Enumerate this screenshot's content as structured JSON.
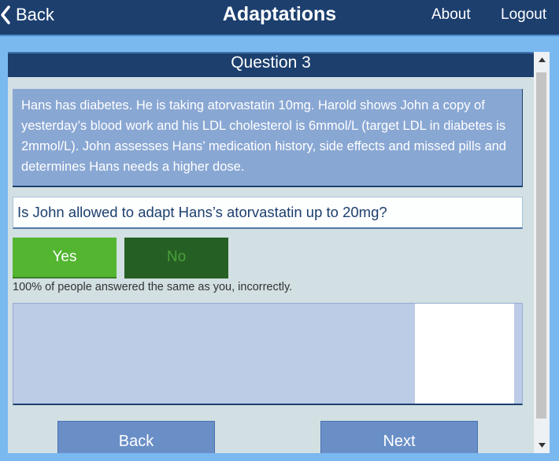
{
  "header": {
    "back_label": "Back",
    "title": "Adaptations",
    "about_label": "About",
    "logout_label": "Logout"
  },
  "question": {
    "heading": "Question 3",
    "scenario": "Hans has diabetes. He is taking atorvastatin 10mg. Harold shows John a copy of yesterday’s blood work and his LDL cholesterol is 6mmol/L (target LDL in diabetes is 2mmol/L). John assesses Hans’ medication history, side effects and missed pills and determines Hans needs a higher dose.",
    "prompt": "Is John allowed to adapt Hans’s atorvastatin up to 20mg?",
    "answers": {
      "yes": "Yes",
      "no": "No"
    },
    "selected_answer": "Yes",
    "result": "100% of people answered the same as you, incorrectly."
  },
  "navigation": {
    "back_label": "Back",
    "next_label": "Next"
  },
  "colors": {
    "header_bg": "#1c3f6e",
    "page_bg": "#7ab8f0",
    "yes_button": "#53b530",
    "no_button": "#265f23",
    "nav_button": "#6a8fc7"
  },
  "icons": {
    "back": "chevron-left-icon",
    "scroll_up": "arrow-up-icon",
    "scroll_down": "arrow-down-icon"
  }
}
